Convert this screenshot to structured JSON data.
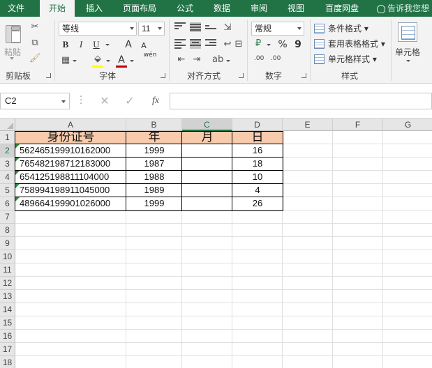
{
  "ribbon": {
    "tabs": [
      {
        "label": "文件"
      },
      {
        "label": "开始",
        "active": true
      },
      {
        "label": "插入"
      },
      {
        "label": "页面布局"
      },
      {
        "label": "公式"
      },
      {
        "label": "数据"
      },
      {
        "label": "审阅"
      },
      {
        "label": "视图"
      },
      {
        "label": "百度网盘"
      }
    ],
    "tell_me": "告诉我您想",
    "groups": {
      "clipboard": {
        "label": "剪贴板",
        "paste_label": "粘贴"
      },
      "font": {
        "label": "字体",
        "font_name": "等线",
        "font_size": "11",
        "bold": "B",
        "italic": "I",
        "underline": "U",
        "grow": "A",
        "shrink": "A",
        "phonetic": "wén"
      },
      "alignment": {
        "label": "对齐方式"
      },
      "number": {
        "label": "数字",
        "format": "常规",
        "percent": "%",
        "comma": "9",
        "inc_decimal": ".00",
        "dec_decimal": ".00"
      },
      "styles": {
        "label": "样式",
        "conditional": "条件格式",
        "table_format": "套用表格格式",
        "cell_styles": "单元格样式"
      },
      "cells": {
        "label": "单元格"
      }
    },
    "colors": {
      "accent": "#217346",
      "font_color": "#c00000",
      "fill_color": "#ffff00"
    }
  },
  "formula_bar": {
    "name_box": "C2",
    "fx": "fx",
    "formula": ""
  },
  "sheet": {
    "columns": [
      "A",
      "B",
      "C",
      "D",
      "E",
      "F",
      "G"
    ],
    "rows": [
      "1",
      "2",
      "3",
      "4",
      "5",
      "6",
      "7",
      "8",
      "9",
      "10",
      "11",
      "12",
      "13",
      "14",
      "15",
      "16",
      "17",
      "18"
    ],
    "header": [
      "身份证号",
      "年",
      "月",
      "日"
    ],
    "data": [
      {
        "id": "562465199910162000",
        "year": "1999",
        "month": "",
        "day": "16"
      },
      {
        "id": "765482198712183000",
        "year": "1987",
        "month": "",
        "day": "18"
      },
      {
        "id": "654125198811104000",
        "year": "1988",
        "month": "",
        "day": "10"
      },
      {
        "id": "758994198911045000",
        "year": "1989",
        "month": "",
        "day": "4"
      },
      {
        "id": "489664199901026000",
        "year": "1999",
        "month": "",
        "day": "26"
      }
    ],
    "selected_cell": "C2",
    "header_fill": "#f8cbad"
  }
}
